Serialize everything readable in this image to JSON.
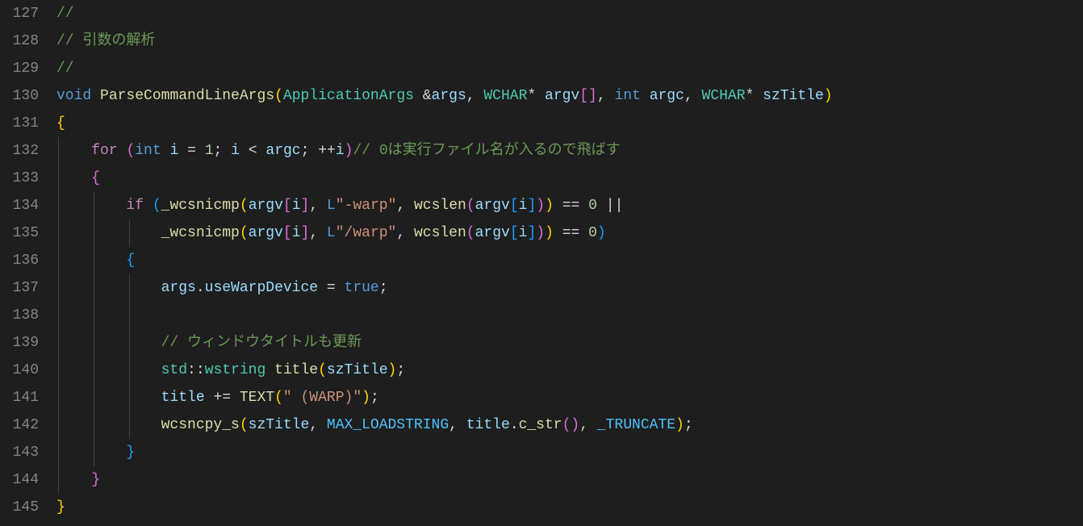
{
  "lines": [
    {
      "num": "127",
      "tokens": [
        {
          "t": "//",
          "c": "comment"
        }
      ]
    },
    {
      "num": "128",
      "tokens": [
        {
          "t": "// 引数の解析",
          "c": "comment"
        }
      ]
    },
    {
      "num": "129",
      "tokens": [
        {
          "t": "//",
          "c": "comment"
        }
      ]
    },
    {
      "num": "130",
      "tokens": [
        {
          "t": "void",
          "c": "keyword"
        },
        {
          "t": " "
        },
        {
          "t": "ParseCommandLineArgs",
          "c": "func"
        },
        {
          "t": "(",
          "c": "brace"
        },
        {
          "t": "ApplicationArgs",
          "c": "type"
        },
        {
          "t": " "
        },
        {
          "t": "&",
          "c": "op"
        },
        {
          "t": "args",
          "c": "var"
        },
        {
          "t": ", "
        },
        {
          "t": "WCHAR",
          "c": "type"
        },
        {
          "t": "*",
          "c": "op"
        },
        {
          "t": " "
        },
        {
          "t": "argv",
          "c": "var"
        },
        {
          "t": "[",
          "c": "brace2"
        },
        {
          "t": "]",
          "c": "brace2"
        },
        {
          "t": ", "
        },
        {
          "t": "int",
          "c": "keyword"
        },
        {
          "t": " "
        },
        {
          "t": "argc",
          "c": "var"
        },
        {
          "t": ", "
        },
        {
          "t": "WCHAR",
          "c": "type"
        },
        {
          "t": "*",
          "c": "op"
        },
        {
          "t": " "
        },
        {
          "t": "szTitle",
          "c": "var"
        },
        {
          "t": ")",
          "c": "brace"
        }
      ]
    },
    {
      "num": "131",
      "tokens": [
        {
          "t": "{",
          "c": "brace"
        }
      ]
    },
    {
      "num": "132",
      "indent": 1,
      "tokens": [
        {
          "t": "    "
        },
        {
          "t": "for",
          "c": "control"
        },
        {
          "t": " "
        },
        {
          "t": "(",
          "c": "brace2"
        },
        {
          "t": "int",
          "c": "keyword"
        },
        {
          "t": " "
        },
        {
          "t": "i",
          "c": "var"
        },
        {
          "t": " "
        },
        {
          "t": "=",
          "c": "op"
        },
        {
          "t": " "
        },
        {
          "t": "1",
          "c": "number"
        },
        {
          "t": "; "
        },
        {
          "t": "i",
          "c": "var"
        },
        {
          "t": " "
        },
        {
          "t": "<",
          "c": "op"
        },
        {
          "t": " "
        },
        {
          "t": "argc",
          "c": "var"
        },
        {
          "t": "; "
        },
        {
          "t": "++",
          "c": "op"
        },
        {
          "t": "i",
          "c": "var"
        },
        {
          "t": ")",
          "c": "brace2"
        },
        {
          "t": "// 0は実行ファイル名が入るので飛ばす",
          "c": "comment"
        }
      ]
    },
    {
      "num": "133",
      "indent": 1,
      "tokens": [
        {
          "t": "    "
        },
        {
          "t": "{",
          "c": "brace2"
        }
      ]
    },
    {
      "num": "134",
      "indent": 2,
      "tokens": [
        {
          "t": "        "
        },
        {
          "t": "if",
          "c": "control"
        },
        {
          "t": " "
        },
        {
          "t": "(",
          "c": "brace3"
        },
        {
          "t": "_wcsnicmp",
          "c": "func"
        },
        {
          "t": "(",
          "c": "brace"
        },
        {
          "t": "argv",
          "c": "var"
        },
        {
          "t": "[",
          "c": "brace2"
        },
        {
          "t": "i",
          "c": "var"
        },
        {
          "t": "]",
          "c": "brace2"
        },
        {
          "t": ", "
        },
        {
          "t": "L",
          "c": "keyword"
        },
        {
          "t": "\"-warp\"",
          "c": "string"
        },
        {
          "t": ", "
        },
        {
          "t": "wcslen",
          "c": "func"
        },
        {
          "t": "(",
          "c": "brace2"
        },
        {
          "t": "argv",
          "c": "var"
        },
        {
          "t": "[",
          "c": "brace3"
        },
        {
          "t": "i",
          "c": "var"
        },
        {
          "t": "]",
          "c": "brace3"
        },
        {
          "t": ")",
          "c": "brace2"
        },
        {
          "t": ")",
          "c": "brace"
        },
        {
          "t": " "
        },
        {
          "t": "==",
          "c": "op"
        },
        {
          "t": " "
        },
        {
          "t": "0",
          "c": "number"
        },
        {
          "t": " "
        },
        {
          "t": "||",
          "c": "op"
        }
      ]
    },
    {
      "num": "135",
      "indent": 3,
      "tokens": [
        {
          "t": "            "
        },
        {
          "t": "_wcsnicmp",
          "c": "func"
        },
        {
          "t": "(",
          "c": "brace"
        },
        {
          "t": "argv",
          "c": "var"
        },
        {
          "t": "[",
          "c": "brace2"
        },
        {
          "t": "i",
          "c": "var"
        },
        {
          "t": "]",
          "c": "brace2"
        },
        {
          "t": ", "
        },
        {
          "t": "L",
          "c": "keyword"
        },
        {
          "t": "\"/warp\"",
          "c": "string"
        },
        {
          "t": ", "
        },
        {
          "t": "wcslen",
          "c": "func"
        },
        {
          "t": "(",
          "c": "brace2"
        },
        {
          "t": "argv",
          "c": "var"
        },
        {
          "t": "[",
          "c": "brace3"
        },
        {
          "t": "i",
          "c": "var"
        },
        {
          "t": "]",
          "c": "brace3"
        },
        {
          "t": ")",
          "c": "brace2"
        },
        {
          "t": ")",
          "c": "brace"
        },
        {
          "t": " "
        },
        {
          "t": "==",
          "c": "op"
        },
        {
          "t": " "
        },
        {
          "t": "0",
          "c": "number"
        },
        {
          "t": ")",
          "c": "brace3"
        }
      ]
    },
    {
      "num": "136",
      "indent": 2,
      "tokens": [
        {
          "t": "        "
        },
        {
          "t": "{",
          "c": "brace3"
        }
      ]
    },
    {
      "num": "137",
      "indent": 3,
      "tokens": [
        {
          "t": "            "
        },
        {
          "t": "args",
          "c": "var"
        },
        {
          "t": "."
        },
        {
          "t": "useWarpDevice",
          "c": "var"
        },
        {
          "t": " "
        },
        {
          "t": "=",
          "c": "op"
        },
        {
          "t": " "
        },
        {
          "t": "true",
          "c": "keyword"
        },
        {
          "t": ";"
        }
      ]
    },
    {
      "num": "138",
      "indent": 3,
      "tokens": []
    },
    {
      "num": "139",
      "indent": 3,
      "tokens": [
        {
          "t": "            "
        },
        {
          "t": "// ウィンドウタイトルも更新",
          "c": "comment"
        }
      ]
    },
    {
      "num": "140",
      "indent": 3,
      "tokens": [
        {
          "t": "            "
        },
        {
          "t": "std",
          "c": "type"
        },
        {
          "t": "::"
        },
        {
          "t": "wstring",
          "c": "type"
        },
        {
          "t": " "
        },
        {
          "t": "title",
          "c": "func"
        },
        {
          "t": "(",
          "c": "brace"
        },
        {
          "t": "szTitle",
          "c": "var"
        },
        {
          "t": ")",
          "c": "brace"
        },
        {
          "t": ";"
        }
      ]
    },
    {
      "num": "141",
      "indent": 3,
      "tokens": [
        {
          "t": "            "
        },
        {
          "t": "title",
          "c": "var"
        },
        {
          "t": " "
        },
        {
          "t": "+=",
          "c": "op"
        },
        {
          "t": " "
        },
        {
          "t": "TEXT",
          "c": "func"
        },
        {
          "t": "(",
          "c": "brace"
        },
        {
          "t": "\" (WARP)\"",
          "c": "string"
        },
        {
          "t": ")",
          "c": "brace"
        },
        {
          "t": ";"
        }
      ]
    },
    {
      "num": "142",
      "indent": 3,
      "tokens": [
        {
          "t": "            "
        },
        {
          "t": "wcsncpy_s",
          "c": "func"
        },
        {
          "t": "(",
          "c": "brace"
        },
        {
          "t": "szTitle",
          "c": "var"
        },
        {
          "t": ", "
        },
        {
          "t": "MAX_LOADSTRING",
          "c": "const"
        },
        {
          "t": ", "
        },
        {
          "t": "title",
          "c": "var"
        },
        {
          "t": "."
        },
        {
          "t": "c_str",
          "c": "func"
        },
        {
          "t": "(",
          "c": "brace2"
        },
        {
          "t": ")",
          "c": "brace2"
        },
        {
          "t": ", "
        },
        {
          "t": "_TRUNCATE",
          "c": "const"
        },
        {
          "t": ")",
          "c": "brace"
        },
        {
          "t": ";"
        }
      ]
    },
    {
      "num": "143",
      "indent": 2,
      "tokens": [
        {
          "t": "        "
        },
        {
          "t": "}",
          "c": "brace3"
        }
      ]
    },
    {
      "num": "144",
      "indent": 1,
      "tokens": [
        {
          "t": "    "
        },
        {
          "t": "}",
          "c": "brace2"
        }
      ]
    },
    {
      "num": "145",
      "tokens": [
        {
          "t": "}",
          "c": "brace"
        }
      ]
    }
  ]
}
